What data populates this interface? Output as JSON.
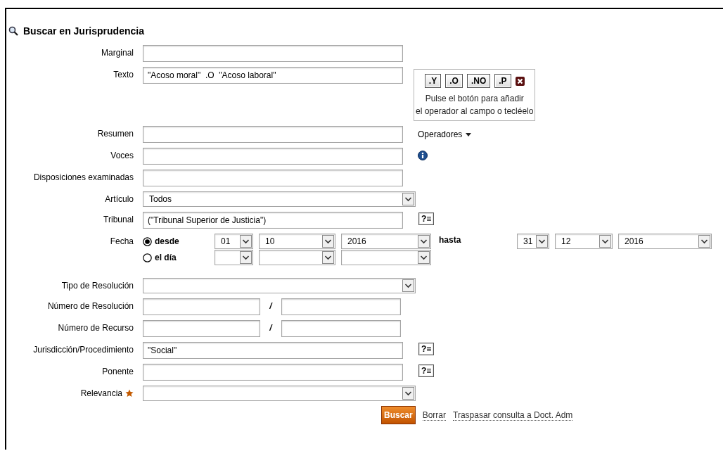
{
  "title": "Buscar en Jurisprudencia",
  "fields": [
    {
      "kind": "text",
      "label": "Marginal"
    },
    {
      "kind": "text",
      "label": "Texto",
      "value": "\"Acoso moral\"  .O  \"Acoso laboral\"",
      "operators": {
        "buttons": [
          ".Y",
          ".O",
          ".NO",
          ".P"
        ],
        "hint": [
          "Pulse el botón para añadir",
          "el operador al campo o tecléelo"
        ]
      }
    },
    {
      "kind": "text",
      "label": "Resumen",
      "menu": "Operadores"
    },
    {
      "kind": "text",
      "label": "Voces",
      "info": true
    },
    {
      "kind": "text",
      "label": "Disposiciones examinadas"
    },
    {
      "kind": "select",
      "label": "Artículo",
      "value": "Todos"
    },
    {
      "kind": "text",
      "label": "Tribunal",
      "value": "(\"Tribunal Superior de Justicia\")",
      "lookup": "?≡"
    },
    {
      "kind": "date",
      "label": "Fecha",
      "modes": [
        {
          "label": "desde",
          "selected": true
        },
        {
          "label": "el día",
          "selected": false
        }
      ],
      "from": [
        "01",
        "10",
        "2016"
      ],
      "connector": "hasta",
      "to": [
        "31",
        "12",
        "2016"
      ]
    },
    {
      "kind": "select",
      "label": "Tipo de Resolución"
    },
    {
      "kind": "split",
      "label": "Número de Resolución",
      "separator": "/"
    },
    {
      "kind": "split",
      "label": "Número de Recurso",
      "separator": "/"
    },
    {
      "kind": "text",
      "label": "Jurisdicción/Procedimiento",
      "value": "\"Social\"",
      "lookup": "?≡"
    },
    {
      "kind": "text",
      "label": "Ponente",
      "lookup": "?≡"
    },
    {
      "kind": "select",
      "label": "Relevancia",
      "starred": true
    }
  ],
  "actions": [
    {
      "kind": "button",
      "label": "Buscar"
    },
    {
      "kind": "link",
      "label": "Borrar"
    },
    {
      "kind": "link",
      "label": "Traspasar consulta a Doct. Adm"
    }
  ]
}
